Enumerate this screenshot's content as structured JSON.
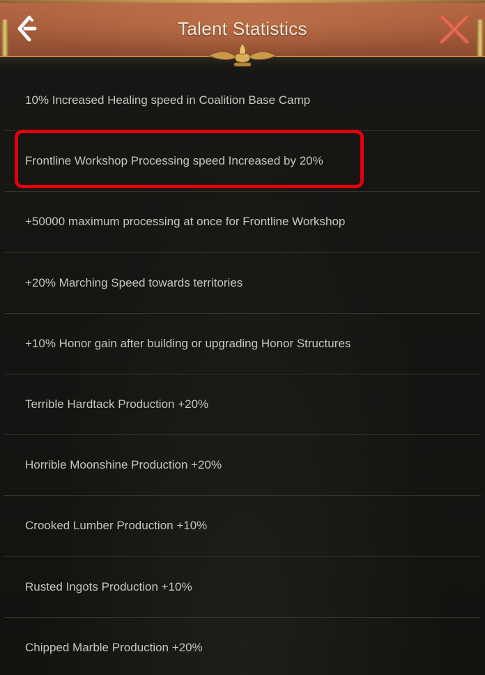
{
  "header": {
    "title": "Talent Statistics",
    "back_icon": "back-arrow-icon",
    "close_icon": "close-x-icon",
    "accent": "#a85e3c"
  },
  "talents": [
    {
      "text": "10% Increased Healing speed in Coalition Base Camp"
    },
    {
      "text": "Frontline Workshop Processing speed Increased by 20%",
      "highlighted": true
    },
    {
      "text": "+50000 maximum processing at once for Frontline Workshop"
    },
    {
      "text": "+20% Marching Speed towards territories"
    },
    {
      "text": "+10% Honor gain after building or upgrading Honor Structures"
    },
    {
      "text": "Terrible Hardtack Production +20%"
    },
    {
      "text": "Horrible Moonshine Production +20%"
    },
    {
      "text": "Crooked Lumber Production +10%"
    },
    {
      "text": "Rusted Ingots Production +10%"
    },
    {
      "text": "Chipped Marble Production +20%"
    }
  ],
  "colors": {
    "background": "#141412",
    "row_text": "#c7c6c0",
    "divider": "#34342e",
    "highlight_border": "#e3000b"
  }
}
